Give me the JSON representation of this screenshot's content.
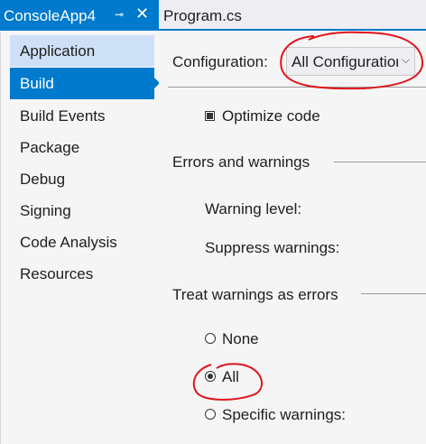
{
  "tabs": {
    "active_title": "ConsoleApp4",
    "pin_glyph": "⊸",
    "close_glyph": "✕",
    "inactive_title": "Program.cs"
  },
  "sidebar": {
    "items": [
      {
        "label": "Application"
      },
      {
        "label": "Build"
      },
      {
        "label": "Build Events"
      },
      {
        "label": "Package"
      },
      {
        "label": "Debug"
      },
      {
        "label": "Signing"
      },
      {
        "label": "Code Analysis"
      },
      {
        "label": "Resources"
      }
    ]
  },
  "main": {
    "configuration_label": "Configuration:",
    "configuration_value": "All Configurations",
    "optimize_code_label": "Optimize code",
    "optimize_code_checked": true,
    "errors_section": "Errors and warnings",
    "warning_level_label": "Warning level:",
    "suppress_warnings_label": "Suppress warnings:",
    "treat_section": "Treat warnings as errors",
    "radio_none": "None",
    "radio_all": "All",
    "radio_specific": "Specific warnings:",
    "selected_radio": "All"
  },
  "colors": {
    "accent": "#007acc",
    "hover": "#cde0f5",
    "annotation": "#e0141c"
  },
  "icons": {
    "pin": "pin-icon",
    "close": "close-icon",
    "dropdown": "chevron-down-icon",
    "nav_arrow": "caret-right-icon"
  }
}
